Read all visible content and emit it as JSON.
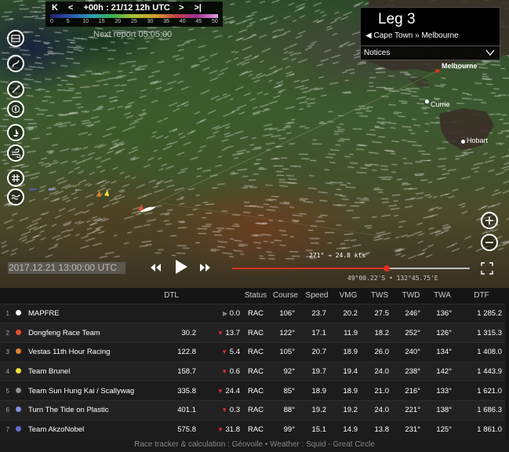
{
  "timebar": {
    "first_label": "K",
    "prev_label": "<",
    "timestamp": "+00h : 21/12 12h UTC",
    "next_label": ">",
    "last_label": ">|",
    "scale_labels": [
      "0",
      "5",
      "10",
      "15",
      "20",
      "25",
      "30",
      "35",
      "40",
      "45",
      "50"
    ]
  },
  "next_report": "Next report 05:05:00",
  "leg": {
    "title": "Leg 3",
    "route": "Cape Town » Melbourne",
    "notices_label": "Notices"
  },
  "cities": {
    "melbourne": "Melbourne",
    "currie": "Currie",
    "hobart": "Hobart"
  },
  "playback": {
    "date": "2017.12.21 13:00:00 UTC",
    "cursor_info": "271° → 24.8 kts",
    "coords": "49°00.22'S • 132°45.75'E",
    "progress": 0.65
  },
  "table": {
    "headers": [
      "DTL",
      "Status",
      "Course",
      "Speed",
      "VMG",
      "TWS",
      "TWD",
      "TWA",
      "DTF"
    ],
    "rows": [
      {
        "rank": "1",
        "color": "#ffffff",
        "name": "MAPFRE",
        "dtl": "",
        "delta": "0.0",
        "delta_dir": "none",
        "status": "RAC",
        "course": "106°",
        "speed": "23.7",
        "vmg": "20.2",
        "tws": "27.5",
        "twd": "246°",
        "twa": "136°",
        "dtf": "1 285.2"
      },
      {
        "rank": "2",
        "color": "#e05030",
        "name": "Dongfeng Race Team",
        "dtl": "30.2",
        "delta": "13.7",
        "delta_dir": "down",
        "status": "RAC",
        "course": "122°",
        "speed": "17.1",
        "vmg": "11.9",
        "tws": "18.2",
        "twd": "252°",
        "twa": "126°",
        "dtf": "1 315.3"
      },
      {
        "rank": "3",
        "color": "#e08030",
        "name": "Vestas 11th Hour Racing",
        "dtl": "122.8",
        "delta": "5.4",
        "delta_dir": "down",
        "status": "RAC",
        "course": "105°",
        "speed": "20.7",
        "vmg": "18.9",
        "tws": "26.0",
        "twd": "240°",
        "twa": "134°",
        "dtf": "1 408.0"
      },
      {
        "rank": "4",
        "color": "#f0e040",
        "name": "Team Brunel",
        "dtl": "158.7",
        "delta": "0.6",
        "delta_dir": "down",
        "status": "RAC",
        "course": "92°",
        "speed": "19.7",
        "vmg": "19.4",
        "tws": "24.0",
        "twd": "238°",
        "twa": "142°",
        "dtf": "1 443.9"
      },
      {
        "rank": "5",
        "color": "#909090",
        "name": "Team Sun Hung Kai / Scallywag",
        "dtl": "335.8",
        "delta": "24.4",
        "delta_dir": "down",
        "status": "RAC",
        "course": "85°",
        "speed": "18.9",
        "vmg": "18.9",
        "tws": "21.0",
        "twd": "216°",
        "twa": "133°",
        "dtf": "1 621.0"
      },
      {
        "rank": "6",
        "color": "#8090e0",
        "name": "Turn The Tide on Plastic",
        "dtl": "401.1",
        "delta": "0.3",
        "delta_dir": "down",
        "status": "RAC",
        "course": "88°",
        "speed": "19.2",
        "vmg": "19.2",
        "tws": "24.0",
        "twd": "221°",
        "twa": "138°",
        "dtf": "1 686.3"
      },
      {
        "rank": "7",
        "color": "#6070d0",
        "name": "Team AkzoNobel",
        "dtl": "575.8",
        "delta": "31.8",
        "delta_dir": "down",
        "status": "RAC",
        "course": "99°",
        "speed": "15.1",
        "vmg": "14.9",
        "tws": "13.8",
        "twd": "231°",
        "twa": "125°",
        "dtf": "1 861.0"
      }
    ]
  },
  "footer": "Race tracker & calculation : Géovoile • Weather : Squid - Great Circle",
  "icons": [
    "layers-icon",
    "route-icon",
    "wind-icon",
    "compass-icon",
    "boat-icon",
    "weather-icon",
    "grid-icon",
    "waves-icon",
    "zoom-in-icon",
    "zoom-out-icon",
    "fullscreen-icon",
    "rewind-icon",
    "play-icon",
    "fast-forward-icon",
    "chevron-down-icon"
  ]
}
